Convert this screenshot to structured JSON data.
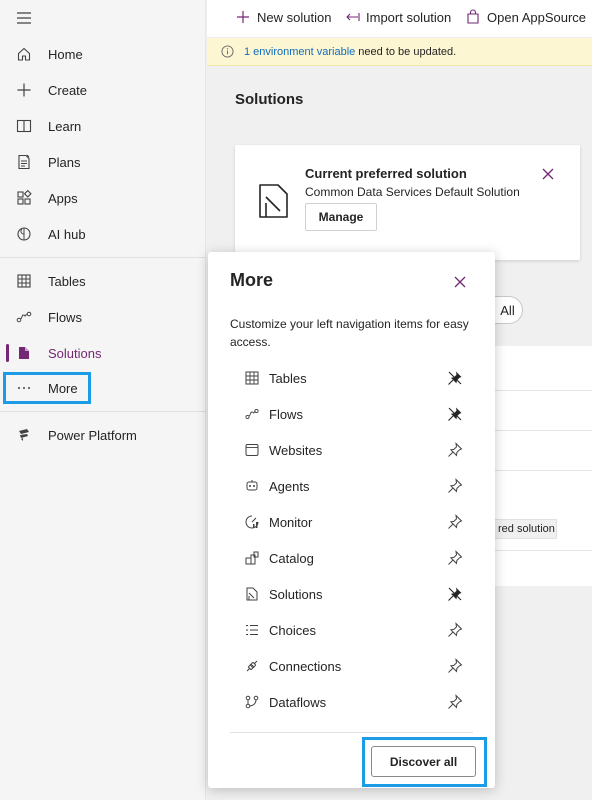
{
  "command_bar": {
    "new_solution": "New solution",
    "import_solution": "Import solution",
    "open_appsource": "Open AppSource"
  },
  "banner": {
    "link_text": "1 environment variable",
    "text": "need to be updated."
  },
  "nav": {
    "items": [
      {
        "label": "Home",
        "icon": "home-icon"
      },
      {
        "label": "Create",
        "icon": "plus-icon"
      },
      {
        "label": "Learn",
        "icon": "book-icon"
      },
      {
        "label": "Plans",
        "icon": "plans-icon"
      },
      {
        "label": "Apps",
        "icon": "apps-icon"
      },
      {
        "label": "AI hub",
        "icon": "ai-hub-icon"
      },
      {
        "label": "Tables",
        "icon": "table-icon"
      },
      {
        "label": "Flows",
        "icon": "flows-icon"
      },
      {
        "label": "Solutions",
        "icon": "solutions-icon",
        "active": true
      },
      {
        "label": "More",
        "icon": "more-icon"
      },
      {
        "label": "Power Platform",
        "icon": "power-platform-icon"
      }
    ]
  },
  "main": {
    "title": "Solutions",
    "card": {
      "title": "Current preferred solution",
      "subtitle": "Common Data Services Default Solution",
      "manage_label": "Manage"
    },
    "filter_all": "All",
    "tag_text": "red solution"
  },
  "flyout": {
    "title": "More",
    "description": "Customize your left navigation items for easy access.",
    "items": [
      {
        "label": "Tables",
        "icon": "table-icon",
        "pinned": true
      },
      {
        "label": "Flows",
        "icon": "flows-icon",
        "pinned": true
      },
      {
        "label": "Websites",
        "icon": "websites-icon",
        "pinned": false
      },
      {
        "label": "Agents",
        "icon": "agents-icon",
        "pinned": false
      },
      {
        "label": "Monitor",
        "icon": "monitor-icon",
        "pinned": false
      },
      {
        "label": "Catalog",
        "icon": "catalog-icon",
        "pinned": false
      },
      {
        "label": "Solutions",
        "icon": "solutions-icon",
        "pinned": true
      },
      {
        "label": "Choices",
        "icon": "choices-icon",
        "pinned": false
      },
      {
        "label": "Connections",
        "icon": "connections-icon",
        "pinned": false
      },
      {
        "label": "Dataflows",
        "icon": "dataflows-icon",
        "pinned": false
      }
    ],
    "discover_label": "Discover all"
  },
  "colors": {
    "accent_purple": "#742774",
    "highlight_blue": "#1c9be6",
    "banner_bg": "#fdf6d2",
    "link_blue": "#0f6cbd"
  }
}
